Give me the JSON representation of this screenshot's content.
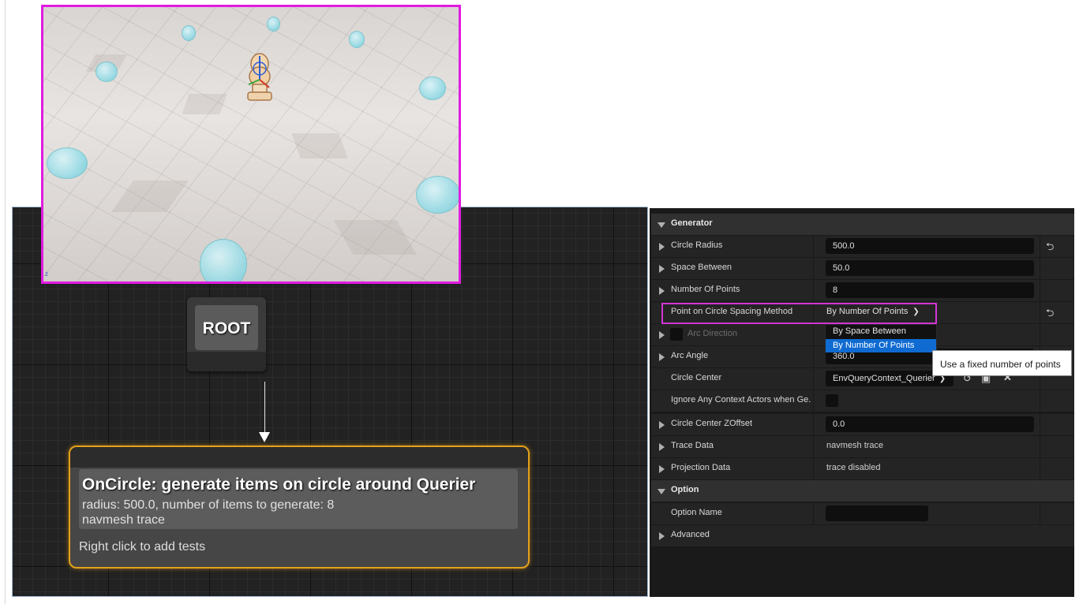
{
  "graph": {
    "root_label": "ROOT",
    "generator_title": "OnCircle: generate items on circle around Querier",
    "generator_line1": "radius: 500.0, number of items to generate: 8",
    "generator_line2": "navmesh trace",
    "generator_hint": "Right click to add tests"
  },
  "details": {
    "generator_section": "Generator",
    "circle_radius_label": "Circle Radius",
    "circle_radius_value": "500.0",
    "space_between_label": "Space Between",
    "space_between_value": "50.0",
    "number_of_points_label": "Number Of Points",
    "number_of_points_value": "8",
    "spacing_method_label": "Point on Circle Spacing Method",
    "spacing_method_value": "By Number Of Points",
    "arc_direction_label": "Arc Direction",
    "arc_angle_label": "Arc Angle",
    "arc_angle_value": "360.0",
    "circle_center_label": "Circle Center",
    "circle_center_value": "EnvQueryContext_Querier",
    "ignore_context_label": "Ignore Any Context Actors when Ge...",
    "zoffset_label": "Circle Center ZOffset",
    "zoffset_value": "0.0",
    "trace_data_label": "Trace Data",
    "trace_data_value": "navmesh trace",
    "projection_data_label": "Projection Data",
    "projection_data_value": "trace disabled",
    "option_section": "Option",
    "option_name_label": "Option Name",
    "option_name_value": "",
    "advanced_label": "Advanced"
  },
  "dropdown": {
    "options": [
      "By Space Between",
      "By Number Of Points"
    ],
    "selected": "By Number Of Points"
  },
  "tooltip": "Use a fixed number of points",
  "icons": {
    "reset": "reset-arrow-icon",
    "chevron": "chevron-down-icon",
    "use_selected": "use-selected-icon",
    "browse": "browse-icon",
    "clear": "clear-icon"
  },
  "colors": {
    "highlight": "#e11be1",
    "node_border": "#e4a11a",
    "selection_blue": "#0f6bd1"
  }
}
